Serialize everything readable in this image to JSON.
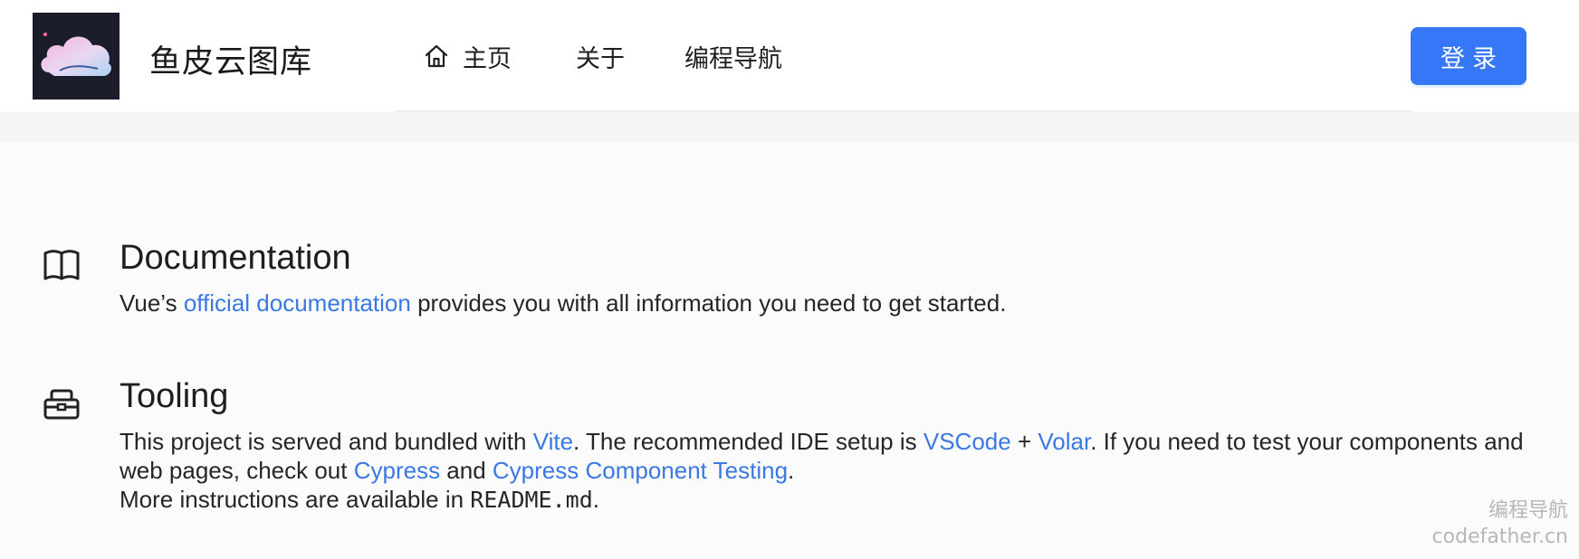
{
  "header": {
    "logo_alt": "cloud-logo",
    "site_title": "鱼皮云图库",
    "nav": [
      {
        "label": "主页",
        "icon": "home-icon"
      },
      {
        "label": "关于"
      },
      {
        "label": "编程导航"
      }
    ],
    "login_label": "登录"
  },
  "sections": {
    "documentation": {
      "icon": "book-icon",
      "title": "Documentation",
      "text_1": "Vue’s ",
      "link_1": "official documentation",
      "text_2": " provides you with all information you need to get started."
    },
    "tooling": {
      "icon": "toolbox-icon",
      "title": "Tooling",
      "text_1": "This project is served and bundled with ",
      "link_vite": "Vite",
      "text_2": ". The recommended IDE setup is ",
      "link_vscode": "VSCode",
      "text_3": " + ",
      "link_volar": "Volar",
      "text_4": ". If you need to test your components and web pages, check out ",
      "link_cypress": "Cypress",
      "text_5": " and ",
      "link_cypress_ct": "Cypress Component Testing",
      "text_6": ".",
      "line_2_text": "More instructions are available in ",
      "line_2_code": "README.md",
      "line_2_end": "."
    }
  },
  "watermark": {
    "line_1": "编程导航",
    "line_2": "codefather.cn"
  },
  "colors": {
    "accent": "#3577f6",
    "link": "#3a78e3",
    "header_bg": "#ffffff",
    "page_bg": "#fbfbfb"
  }
}
